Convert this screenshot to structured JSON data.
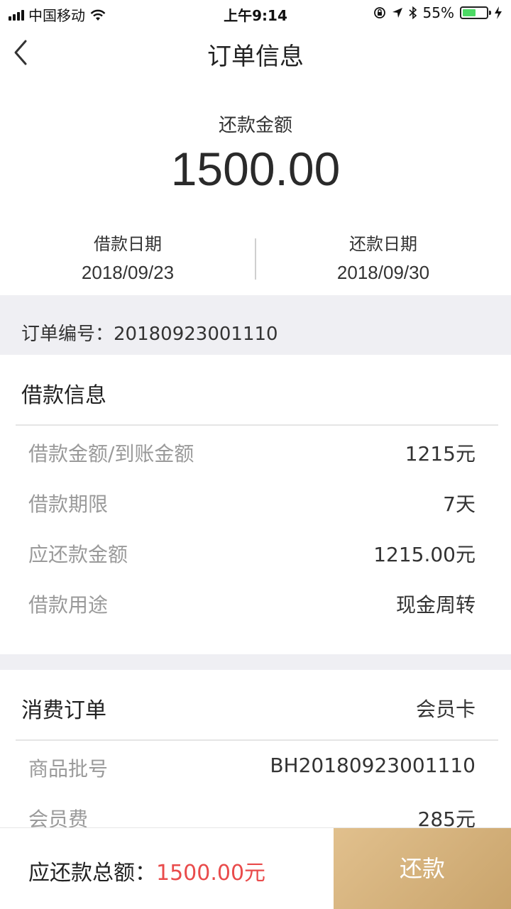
{
  "status_bar": {
    "carrier": "中国移动",
    "time": "上午9:14",
    "battery": "55%",
    "battery_level": 0.55,
    "icons": [
      "signal-icon",
      "wifi-icon",
      "rotation-lock-icon",
      "location-icon",
      "bluetooth-icon",
      "battery-icon",
      "charging-icon"
    ]
  },
  "nav": {
    "title": "订单信息",
    "back_icon": "chevron-left-icon"
  },
  "summary": {
    "amount_label": "还款金额",
    "amount_value": "1500.00",
    "borrow_date_label": "借款日期",
    "borrow_date": "2018/09/23",
    "repay_date_label": "还款日期",
    "repay_date": "2018/09/30"
  },
  "order": {
    "order_no_label": "订单编号：20180923001110"
  },
  "loan_info": {
    "title": "借款信息",
    "rows": [
      {
        "label": "借款金额/到账金额",
        "value": "1215元"
      },
      {
        "label": "借款期限",
        "value": "7天"
      },
      {
        "label": "应还款金额",
        "value": "1215.00元"
      },
      {
        "label": "借款用途",
        "value": "现金周转"
      }
    ]
  },
  "consumption_order": {
    "title": "消费订单",
    "type": "会员卡",
    "rows": [
      {
        "label": "商品批号",
        "value": "BH20180923001110"
      },
      {
        "label": "会员费",
        "value": "285元"
      }
    ]
  },
  "footer": {
    "total_label": "应还款总额：",
    "total_amount": "1500.00元",
    "pay_button": "还款"
  },
  "colors": {
    "accent_gold": "#d4b17c",
    "amount_red": "#e94b4b",
    "band_gray": "#efeff3"
  }
}
